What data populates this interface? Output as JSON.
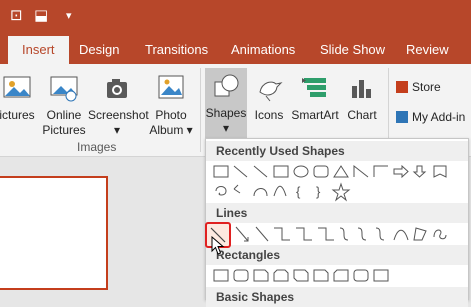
{
  "quick_access": {
    "icons": [
      "presenter-icon",
      "customize-icon"
    ]
  },
  "tabs": [
    {
      "label": "Insert",
      "active": true
    },
    {
      "label": "Design"
    },
    {
      "label": "Transitions"
    },
    {
      "label": "Animations"
    },
    {
      "label": "Slide Show"
    },
    {
      "label": "Review"
    }
  ],
  "ribbon": {
    "pictures": {
      "label_line1": "ictures"
    },
    "online_pictures": {
      "label_line1": "Online",
      "label_line2": "Pictures"
    },
    "screenshot": {
      "label_line1": "Screenshot",
      "label_line2": "▾"
    },
    "photo_album": {
      "label_line1": "Photo",
      "label_line2": "Album ▾"
    },
    "shapes": {
      "label_line1": "Shapes",
      "label_line2": "▾"
    },
    "icons": {
      "label_line1": "Icons"
    },
    "smartart": {
      "label_line1": "SmartArt"
    },
    "chart": {
      "label_line1": "Chart"
    },
    "store": {
      "label": "Store"
    },
    "my_addins": {
      "label": "My Add-in"
    },
    "group_images": "Images"
  },
  "shapes_menu": {
    "recently_used": "Recently Used Shapes",
    "lines": "Lines",
    "rectangles": "Rectangles",
    "basic_shapes": "Basic Shapes"
  },
  "colors": {
    "accent": "#b7472a",
    "selection": "#e02020"
  }
}
